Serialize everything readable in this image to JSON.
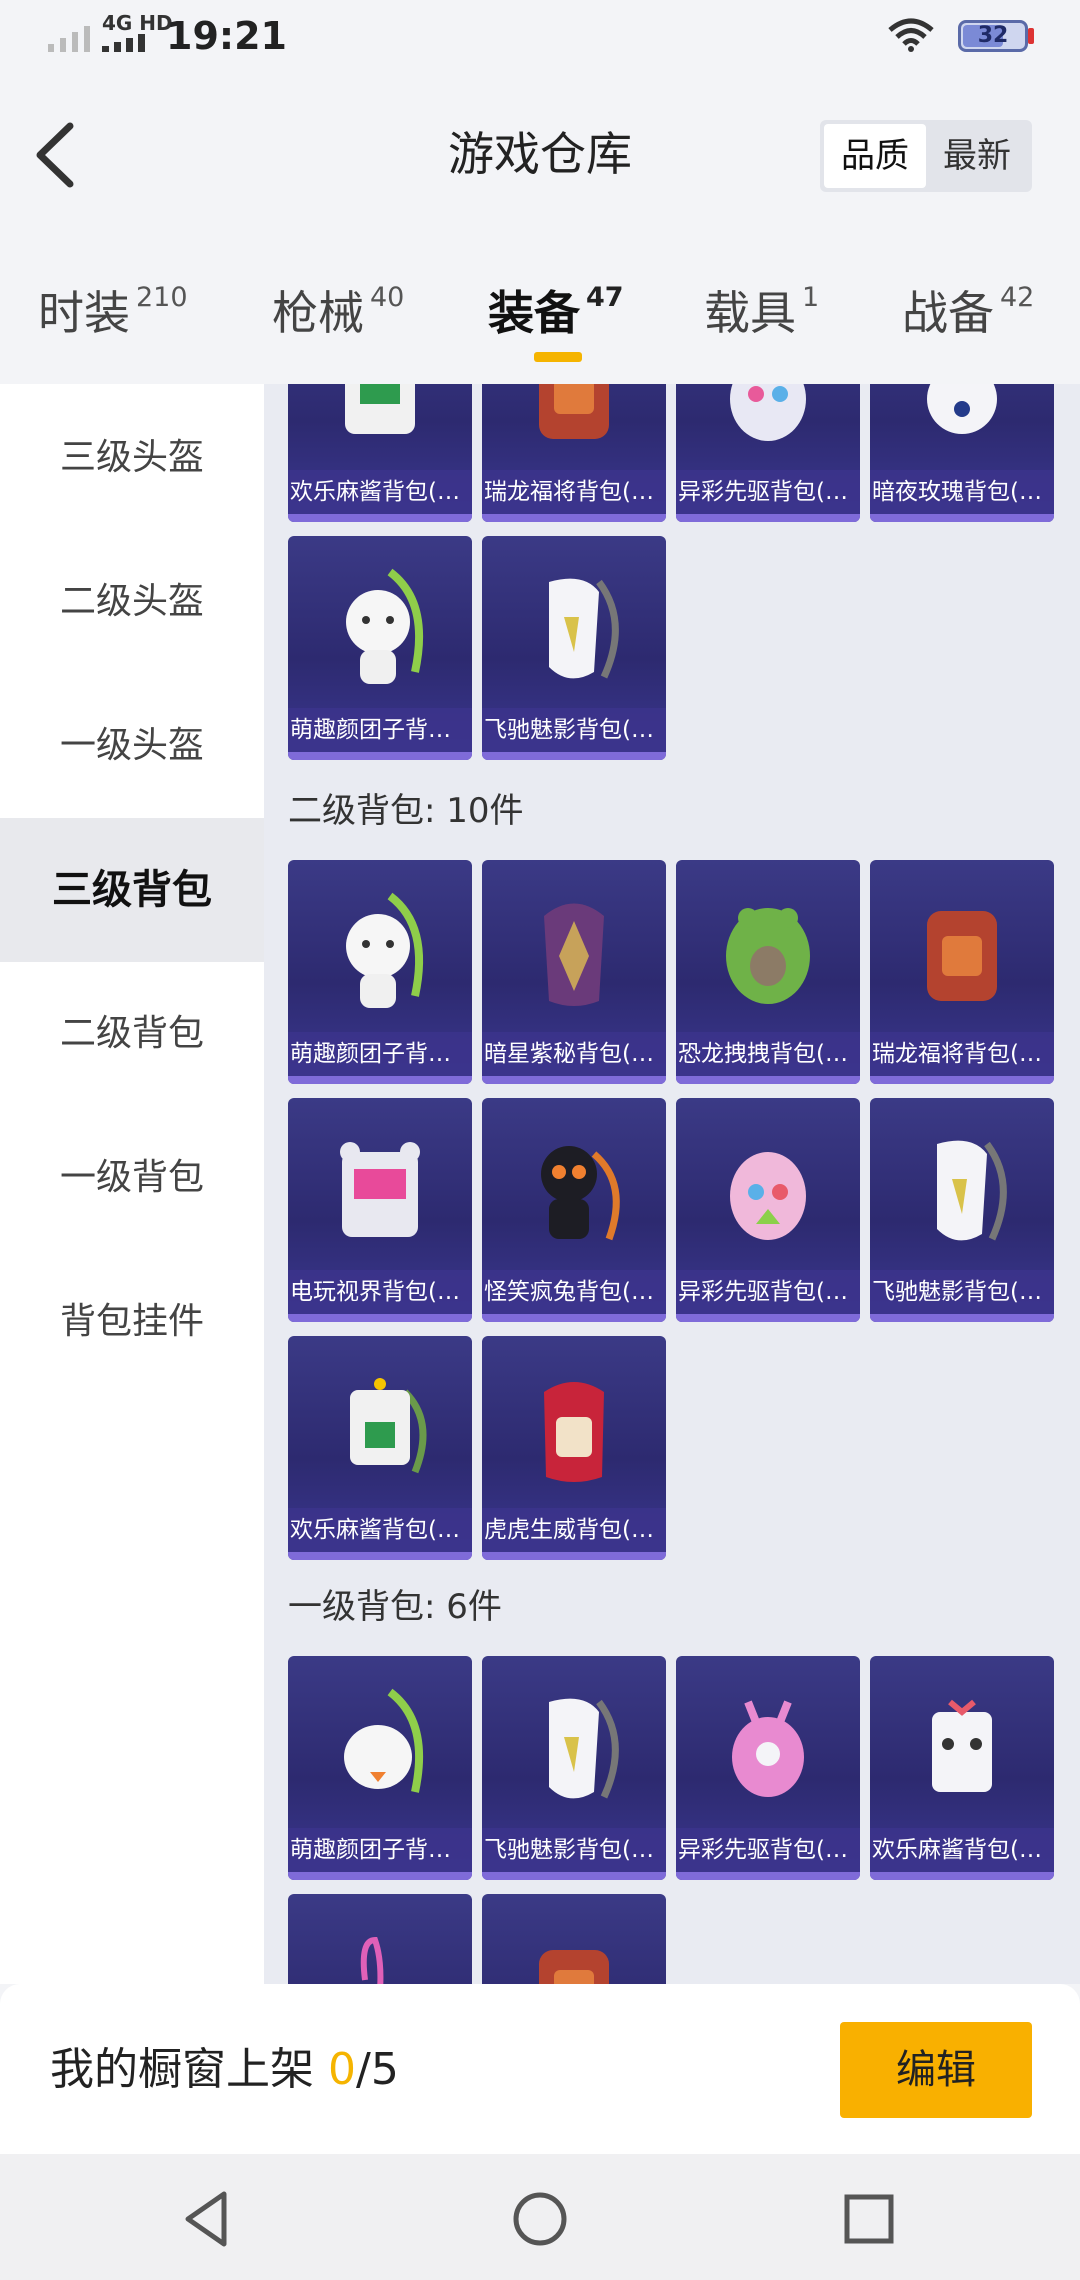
{
  "status_bar": {
    "network": "4G HD",
    "time": "19:21",
    "battery": "32"
  },
  "header": {
    "title": "游戏仓库",
    "sort_options": [
      "品质",
      "最新"
    ]
  },
  "tabs": [
    {
      "label": "时装",
      "count": "210"
    },
    {
      "label": "枪械",
      "count": "40"
    },
    {
      "label": "装备",
      "count": "47"
    },
    {
      "label": "载具",
      "count": "1"
    },
    {
      "label": "战备",
      "count": "42"
    }
  ],
  "sidebar": {
    "items": [
      "三级头盔",
      "二级头盔",
      "一级头盔",
      "三级背包",
      "二级背包",
      "一级背包",
      "背包挂件"
    ],
    "active": "三级背包"
  },
  "sections": {
    "level3": {
      "items": [
        "欢乐麻酱背包(3…",
        "瑞龙福将背包(3…",
        "异彩先驱背包(3…",
        "暗夜玫瑰背包(3…",
        "萌趣颜团子背包…",
        "飞驰魅影背包(3…"
      ]
    },
    "level2": {
      "title": "二级背包: 10件",
      "items": [
        "萌趣颜团子背包…",
        "暗星紫秘背包(2…",
        "恐龙拽拽背包(2…",
        "瑞龙福将背包(2…",
        "电玩视界背包(2…",
        "怪笑疯兔背包(2…",
        "异彩先驱背包(2…",
        "飞驰魅影背包(2…",
        "欢乐麻酱背包(2…",
        "虎虎生威背包(2…"
      ]
    },
    "level1": {
      "title": "一级背包: 6件",
      "items": [
        "萌趣颜团子背包…",
        "飞驰魅影背包(1…",
        "异彩先驱背包(1…",
        "欢乐麻酱背包(1…",
        "",
        ""
      ]
    }
  },
  "footer": {
    "showcase_label": "我的橱窗上架",
    "showcase_current": "0",
    "showcase_total": "/5",
    "edit_label": "编辑"
  },
  "colors": {
    "accent": "#f5b400",
    "card_bg": "#2d2a70"
  }
}
